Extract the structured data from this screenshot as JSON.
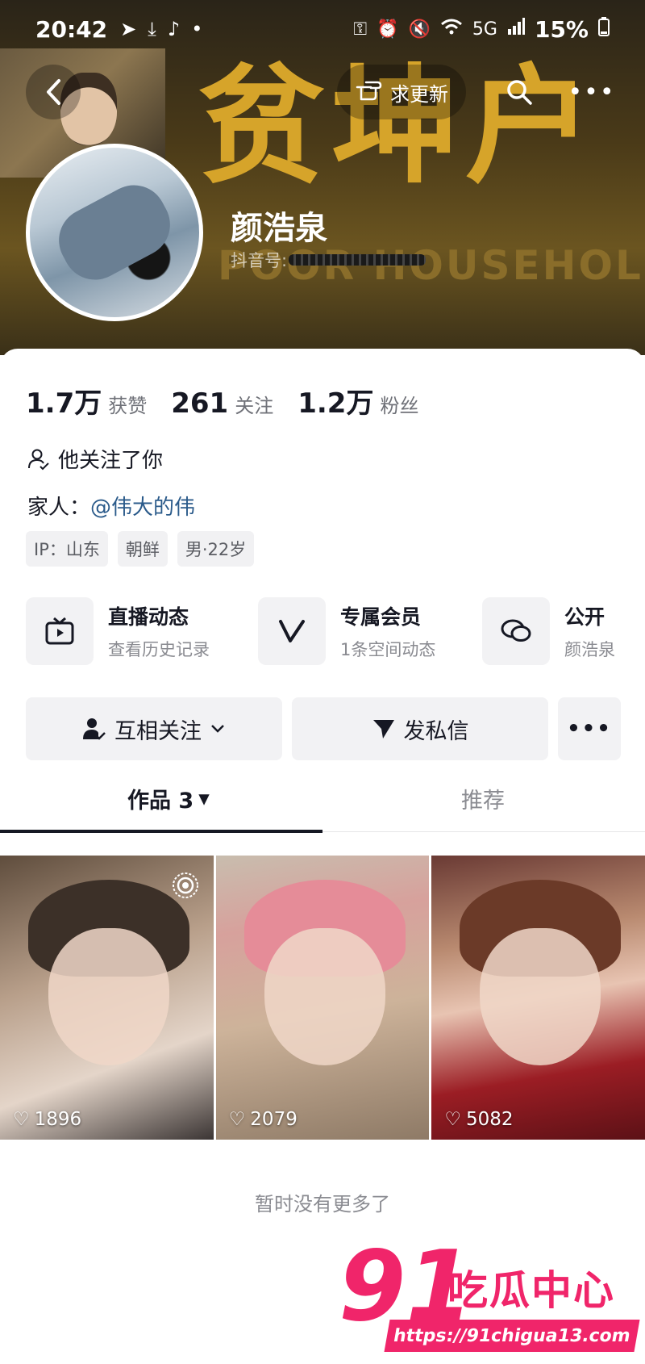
{
  "status_bar": {
    "time": "20:42",
    "network": "5G",
    "battery": "15%"
  },
  "header": {
    "update_request_label": "求更新",
    "banner_text": "贫坤户",
    "banner_subtext": "POOR HOUSEHOLDS"
  },
  "profile": {
    "username": "颜浩泉",
    "douyin_id_label": "抖音号:"
  },
  "stats": [
    {
      "value": "1.7万",
      "label": "获赞"
    },
    {
      "value": "261",
      "label": "关注"
    },
    {
      "value": "1.2万",
      "label": "粉丝"
    }
  ],
  "bio": {
    "follows_you": "他关注了你",
    "family_label": "家人：",
    "family_link": "@伟大的伟"
  },
  "tags": [
    "IP：山东",
    "朝鲜",
    "男·22岁"
  ],
  "features": [
    {
      "title": "直播动态",
      "subtitle": "查看历史记录",
      "icon": "tv-icon"
    },
    {
      "title": "专属会员",
      "subtitle": "1条空间动态",
      "icon": "v-icon"
    },
    {
      "title": "公开",
      "subtitle": "颜浩泉",
      "icon": "chat-icon"
    }
  ],
  "actions": {
    "mutual_follow": "互相关注",
    "message": "发私信"
  },
  "tabs": {
    "works": "作品 3",
    "recommended": "推荐"
  },
  "videos": [
    {
      "likes": "1896"
    },
    {
      "likes": "2079"
    },
    {
      "likes": "5082"
    }
  ],
  "footer": {
    "no_more": "暂时没有更多了"
  },
  "watermark": {
    "number": "91",
    "name": "吃瓜中心",
    "url": "https://91chigua13.com"
  },
  "colors": {
    "banner_gold": "#d6a42a",
    "link_blue": "#2a5a8a",
    "watermark_pink": "#f0256a"
  }
}
